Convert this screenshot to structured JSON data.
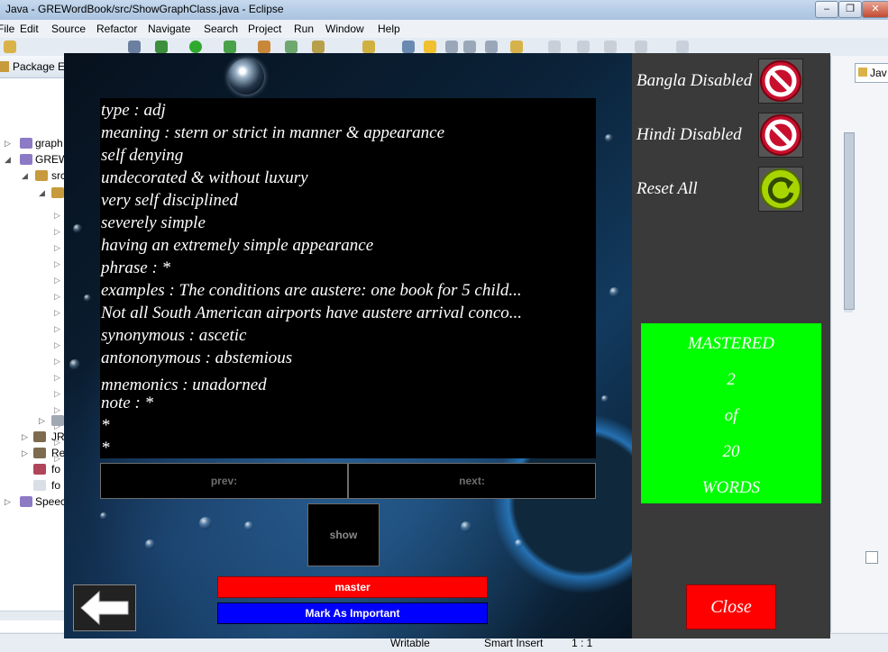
{
  "eclipse": {
    "title": "Java - GREWordBook/src/ShowGraphClass.java - Eclipse",
    "menus": [
      "File",
      "Edit",
      "Source",
      "Refactor",
      "Navigate",
      "Search",
      "Project",
      "Run",
      "Window",
      "Help"
    ],
    "explorer_tab": "Package Ex",
    "tree": [
      "graph",
      "GREW",
      "src",
      "JR",
      "Re",
      "fo",
      "fo",
      "Speec"
    ],
    "perspective": "Jav",
    "status": {
      "writable": "Writable",
      "insert_mode": "Smart Insert",
      "position": "1 : 1"
    }
  },
  "word_card": {
    "lines": [
      "type : adj",
      "meaning : stern or strict in manner & appearance",
      "self denying",
      "undecorated & without luxury",
      "very self disciplined",
      "severely simple",
      "having an extremely simple appearance",
      "phrase : *",
      "examples : The conditions are austere: one book for 5 child...",
      "Not all South American airports have austere arrival conco...",
      "synonymous : ascetic",
      "antononymous : abstemious",
      "mnemonics : unadorned",
      "note : *",
      "*",
      "*"
    ]
  },
  "controls": {
    "prev": "prev:",
    "next": "next:",
    "show": "show",
    "master": "master",
    "important": "Mark As Important",
    "close": "Close"
  },
  "side": {
    "bangla": "Bangla Disabled",
    "hindi": "Hindi Disabled",
    "reset": "Reset All"
  },
  "progress": {
    "label_top": "MASTERED",
    "mastered": "2",
    "of": "of",
    "total": "20",
    "label_bottom": "WORDS"
  },
  "colors": {
    "master": "#ff0000",
    "important": "#0000ff",
    "mastered_panel": "#00ff00",
    "disabled_icon": "#c8102e",
    "reset_icon": "#a8d400"
  },
  "icons": {
    "bangla": "no-entry-icon",
    "hindi": "no-entry-icon",
    "reset": "refresh-icon",
    "back": "back-arrow-icon"
  }
}
